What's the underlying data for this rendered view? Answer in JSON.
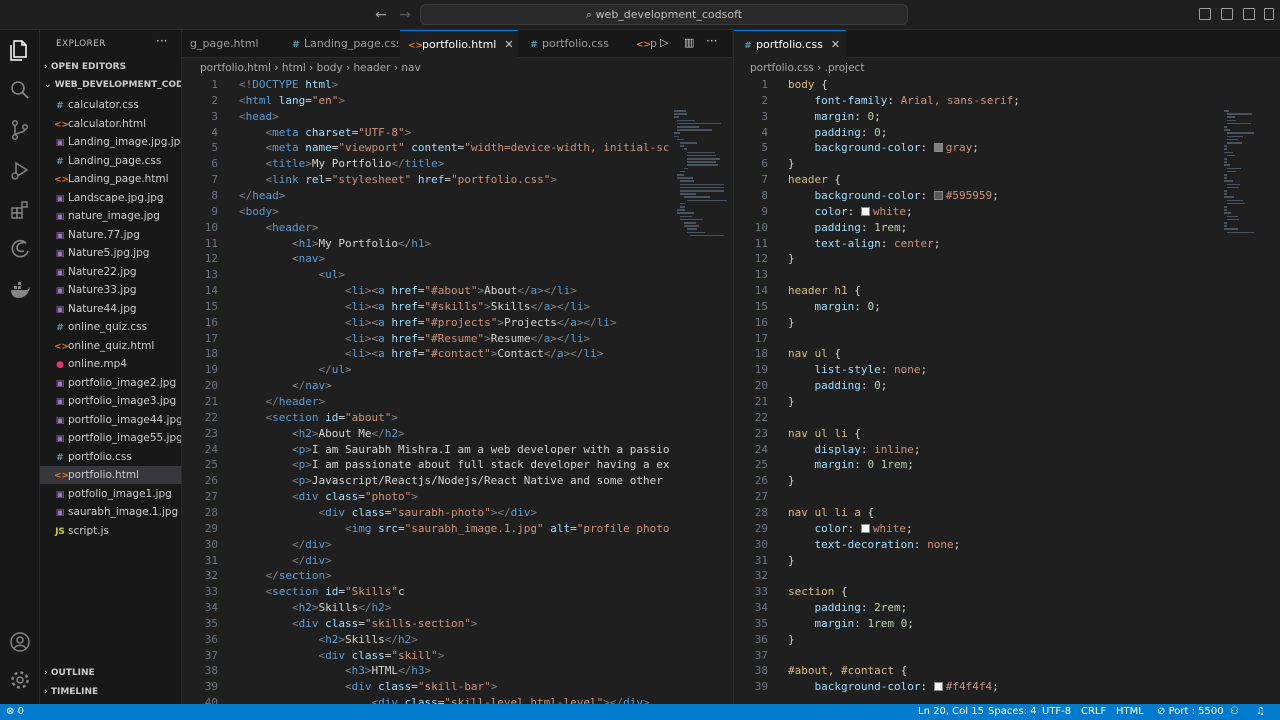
{
  "titlebar": {
    "search_text": "web_development_codsoft"
  },
  "sidebar": {
    "header": "EXPLORER",
    "open_editors": "OPEN EDITORS",
    "folder": "WEB_DEVELOPMENT_COD...",
    "files": [
      {
        "name": "calculator.css",
        "icon": "#",
        "color": "#519aba"
      },
      {
        "name": "calculator.html",
        "icon": "<>",
        "color": "#e37933"
      },
      {
        "name": "Landing_image.jpg.jpg",
        "icon": "▣",
        "color": "#a074c4"
      },
      {
        "name": "Landing_page.css",
        "icon": "#",
        "color": "#519aba"
      },
      {
        "name": "Landing_page.html",
        "icon": "<>",
        "color": "#e37933"
      },
      {
        "name": "Landscape.jpg.jpg",
        "icon": "▣",
        "color": "#a074c4"
      },
      {
        "name": "nature_image.jpg",
        "icon": "▣",
        "color": "#a074c4"
      },
      {
        "name": "Nature.77.jpg",
        "icon": "▣",
        "color": "#a074c4"
      },
      {
        "name": "Nature5.jpg.jpg",
        "icon": "▣",
        "color": "#a074c4"
      },
      {
        "name": "Nature22.jpg",
        "icon": "▣",
        "color": "#a074c4"
      },
      {
        "name": "Nature33.jpg",
        "icon": "▣",
        "color": "#a074c4"
      },
      {
        "name": "Nature44.jpg",
        "icon": "▣",
        "color": "#a074c4"
      },
      {
        "name": "online_quiz.css",
        "icon": "#",
        "color": "#519aba"
      },
      {
        "name": "online_quiz.html",
        "icon": "<>",
        "color": "#e37933"
      },
      {
        "name": "online.mp4",
        "icon": "●",
        "color": "#e33371"
      },
      {
        "name": "portfolio_image2.jpg",
        "icon": "▣",
        "color": "#a074c4"
      },
      {
        "name": "portfolio_image3.jpg",
        "icon": "▣",
        "color": "#a074c4"
      },
      {
        "name": "portfolio_image44.jpg",
        "icon": "▣",
        "color": "#a074c4"
      },
      {
        "name": "portfolio_image55.jpg",
        "icon": "▣",
        "color": "#a074c4"
      },
      {
        "name": "portfolio.css",
        "icon": "#",
        "color": "#519aba"
      },
      {
        "name": "portfolio.html",
        "icon": "<>",
        "color": "#e37933",
        "active": true
      },
      {
        "name": "potfolio_image1.jpg",
        "icon": "▣",
        "color": "#a074c4"
      },
      {
        "name": "saurabh_image.1.jpg",
        "icon": "▣",
        "color": "#a074c4"
      },
      {
        "name": "script.js",
        "icon": "JS",
        "color": "#cbcb41"
      }
    ],
    "outline": "OUTLINE",
    "timeline": "TIMELINE"
  },
  "editor1": {
    "tabs": [
      {
        "label": "g_page.html",
        "icon": "<>"
      },
      {
        "label": "Landing_page.css",
        "icon": "#"
      },
      {
        "label": "portfolio.html",
        "icon": "<>",
        "active": true,
        "close": "✕"
      },
      {
        "label": "portfolio.css",
        "icon": "#"
      },
      {
        "label": "p",
        "icon": "<>"
      }
    ],
    "breadcrumbs": [
      "portfolio.html",
      "html",
      "body",
      "header",
      "nav"
    ]
  },
  "editor2": {
    "tab": {
      "label": "portfolio.css",
      "close": "✕"
    },
    "breadcrumbs": [
      "portfolio.css",
      ".project"
    ]
  },
  "html_code": [
    "[[tg,<!]][[t,DOCTYPE]] [[a,html]][[tg,>]]",
    "[[tg,<]][[t,html]] [[a,lang]][[p,=]][[s,\"en\"]][[tg,>]]",
    "[[tg,<]][[t,head]][[tg,>]]",
    "    [[tg,<]][[t,meta]] [[a,charset]][[p,=]][[s,\"UTF-8\"]][[tg,>]]",
    "    [[tg,<]][[t,meta]] [[a,name]][[p,=]][[s,\"viewport\"]] [[a,content]][[p,=]][[s,\"width=device-width, initial-scal]]",
    "    [[tg,<]][[t,title]][[tg,>]][[tx,My Portfolio]][[tg,</]][[t,title]][[tg,>]]",
    "    [[tg,<]][[t,link]] [[a,rel]][[p,=]][[s,\"stylesheet\"]] [[a,href]][[p,=]][[s,\"portfolio.css\"]][[tg,>]]",
    "[[tg,</]][[t,head]][[tg,>]]",
    "[[tg,<]][[t,body]][[tg,>]]",
    "    [[tg,<]][[t,header]][[tg,>]]",
    "        [[tg,<]][[t,h1]][[tg,>]][[tx,My Portfolio]][[tg,</]][[t,h1]][[tg,>]]",
    "        [[tg,<]][[t,nav]][[tg,>]]",
    "            [[tg,<]][[t,ul]][[tg,>]]",
    "                [[tg,<]][[t,li]][[tg,><]][[t,a]] [[a,href]][[p,=]][[s,\"#about\"]][[tg,>]][[tx,About]][[tg,</]][[t,a]][[tg,></]][[t,li]][[tg,>]]",
    "                [[tg,<]][[t,li]][[tg,><]][[t,a]] [[a,href]][[p,=]][[s,\"#skills\"]][[tg,>]][[tx,Skills]][[tg,</]][[t,a]][[tg,></]][[t,li]][[tg,>]]",
    "                [[tg,<]][[t,li]][[tg,><]][[t,a]] [[a,href]][[p,=]][[s,\"#projects\"]][[tg,>]][[tx,Projects]][[tg,</]][[t,a]][[tg,></]][[t,li]][[tg,>]]",
    "                [[tg,<]][[t,li]][[tg,><]][[t,a]] [[a,href]][[p,=]][[s,\"#Resume\"]][[tg,>]][[tx,Resume]][[tg,</]][[t,a]][[tg,></]][[t,li]][[tg,>]]",
    "                [[tg,<]][[t,li]][[tg,><]][[t,a]] [[a,href]][[p,=]][[s,\"#contact\"]][[tg,>]][[tx,Contact]][[tg,</]][[t,a]][[tg,></]][[t,li]][[tg,>]]",
    "            [[tg,</]][[t,ul]][[tg,>]]",
    "        [[tg,</]][[t,nav]][[tg,>]]",
    "    [[tg,</]][[t,header]][[tg,>]]",
    "    [[tg,<]][[t,section]] [[a,id]][[p,=]][[s,\"about\"]][[tg,>]]",
    "        [[tg,<]][[t,h2]][[tg,>]][[tx,About Me]][[tg,</]][[t,h2]][[tg,>]]",
    "        [[tg,<]][[t,p]][[tg,>]][[tx,I am Saurabh Mishra.I am a web developer with a passion]]",
    "        [[tg,<]][[t,p]][[tg,>]][[tx,I am passionate about full stack developer having a expe]]",
    "        [[tg,<]][[t,p]][[tg,>]][[tx,Javascript/Reactjs/Nodejs/React Native and some other co]]",
    "        [[tg,<]][[t,div]] [[a,class]][[p,=]][[s,\"photo\"]][[tg,>]]",
    "            [[tg,<]][[t,div]] [[a,class]][[p,=]][[s,\"saurabh-photo\"]][[tg,></]][[t,div]][[tg,>]]",
    "                [[tg,<]][[t,img]] [[a,src]][[p,=]][[s,\"saurabh_image.1.jpg\"]] [[a,alt]][[p,=]][[s,\"profile photo\"]]",
    "        [[tg,</]][[t,div]][[tg,>]]",
    "        [[tg,</]][[t,div]][[tg,>]]",
    "    [[tg,</]][[t,section]][[tg,>]]",
    "    [[tg,<]][[t,section]] [[a,id]][[p,=]][[s,\"Skills\"]][[tx,c]]",
    "        [[tg,<]][[t,h2]][[tg,>]][[tx,Skills]][[tg,</]][[t,h2]][[tg,>]]",
    "        [[tg,<]][[t,div]] [[a,class]][[p,=]][[s,\"skills-section\"]][[tg,>]]",
    "            [[tg,<]][[t,h2]][[tg,>]][[tx,Skills]][[tg,</]][[t,h2]][[tg,>]]",
    "            [[tg,<]][[t,div]] [[a,class]][[p,=]][[s,\"skill\"]][[tg,>]]",
    "                [[tg,<]][[t,h3]][[tg,>]][[tx,HTML]][[tg,</]][[t,h3]][[tg,>]]",
    "                [[tg,<]][[t,div]] [[a,class]][[p,=]][[s,\"skill-bar\"]][[tg,>]]",
    "                    [[tg,<]][[t,div]] [[a,class]][[p,=]][[s,\"skill-level html-level\"]][[tg,></]][[t,div]][[tg,>]]"
  ],
  "css_code": [
    "[[sel,body]] [[p,{]]",
    "    [[pr,font-family]][[p,:]] [[v,Arial, sans-serif]][[p,;]]",
    "    [[pr,margin]][[p,:]] [[n,0]][[p,;]]",
    "    [[pr,padding]][[p,:]] [[n,0]][[p,;]]",
    "    [[pr,background-color]][[p,:]] [[sw,#808080]][[v,gray]][[p,;]]",
    "[[p,}]]",
    "[[sel,header]] [[p,{]]",
    "    [[pr,background-color]][[p,:]] [[sw,#595959]][[v,#595959]][[p,;]]",
    "    [[pr,color]][[p,:]] [[sw,#ffffff]][[v,white]][[p,;]]",
    "    [[pr,padding]][[p,:]] [[n,1rem]][[p,;]]",
    "    [[pr,text-align]][[p,:]] [[v,center]][[p,;]]",
    "[[p,}]]",
    "",
    "[[sel,header h1]] [[p,{]]",
    "    [[pr,margin]][[p,:]] [[n,0]][[p,;]]",
    "[[p,}]]",
    "",
    "[[sel,nav ul]] [[p,{]]",
    "    [[pr,list-style]][[p,:]] [[v,none]][[p,;]]",
    "    [[pr,padding]][[p,:]] [[n,0]][[p,;]]",
    "[[p,}]]",
    "",
    "[[sel,nav ul li]] [[p,{]]",
    "    [[pr,display]][[p,:]] [[v,inline]][[p,;]]",
    "    [[pr,margin]][[p,:]] [[n,0 1rem]][[p,;]]",
    "[[p,}]]",
    "",
    "[[sel,nav ul li a]] [[p,{]]",
    "    [[pr,color]][[p,:]] [[sw,#ffffff]][[v,white]][[p,;]]",
    "    [[pr,text-decoration]][[p,:]] [[v,none]][[p,;]]",
    "[[p,}]]",
    "",
    "[[sel,section]] [[p,{]]",
    "    [[pr,padding]][[p,:]] [[n,2rem]][[p,;]]",
    "    [[pr,margin]][[p,:]] [[n,1rem 0]][[p,;]]",
    "[[p,}]]",
    "",
    "[[sel,#about, #contact]] [[p,{]]",
    "    [[pr,background-color]][[p,:]] [[sw,#f4f4f4]][[v,#f4f4f4]][[p,;]]"
  ],
  "statusbar": {
    "errors": "0",
    "position": "Ln 20, Col 15",
    "spaces": "Spaces: 4",
    "encoding": "UTF-8",
    "eol": "CRLF",
    "language": "HTML",
    "port": "Port : 5500"
  }
}
